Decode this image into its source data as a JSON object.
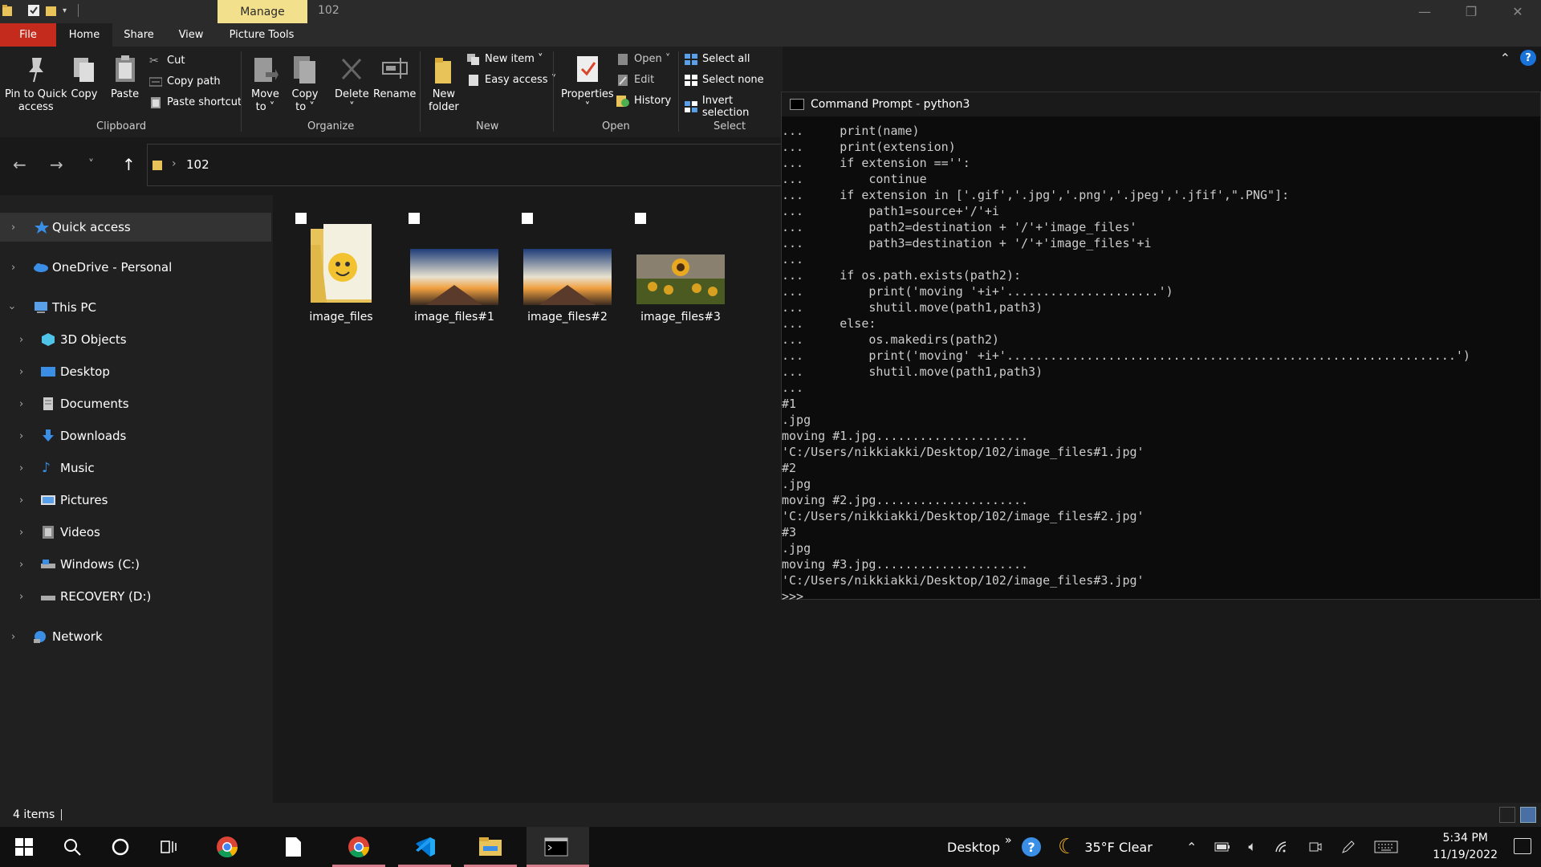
{
  "window": {
    "title": "102",
    "manage_tab": "Manage",
    "minimize": "—",
    "maximize": "❐",
    "close": "✕"
  },
  "ribbon_tabs": [
    "File",
    "Home",
    "Share",
    "View",
    "Picture Tools"
  ],
  "ribbon": {
    "clipboard": {
      "pin": "Pin to Quick",
      "pin2": "access",
      "copy": "Copy",
      "paste": "Paste",
      "cut": "Cut",
      "copy_path": "Copy path",
      "paste_shortcut": "Paste shortcut",
      "label": "Clipboard"
    },
    "organize": {
      "move_to": "Move",
      "move_to2": "to ˅",
      "copy_to": "Copy",
      "copy_to2": "to ˅",
      "delete": "Delete",
      "delete2": "˅",
      "rename": "Rename",
      "label": "Organize"
    },
    "new": {
      "new_folder": "New",
      "new_folder2": "folder",
      "new_item": "New item ˅",
      "easy_access": "Easy access ˅",
      "label": "New"
    },
    "open": {
      "properties": "Properties",
      "properties2": "˅",
      "open": "Open ˅",
      "edit": "Edit",
      "history": "History",
      "label": "Open"
    },
    "select": {
      "select_all": "Select all",
      "select_none": "Select none",
      "invert": "Invert selection",
      "label": "Select"
    }
  },
  "address": {
    "back": "←",
    "forward": "→",
    "recent": "˅",
    "up": "↑",
    "chevron": "›",
    "path": "102"
  },
  "sidebar": [
    {
      "label": "Quick access",
      "icon": "star-icon"
    },
    {
      "label": "OneDrive - Personal",
      "icon": "cloud-icon"
    },
    {
      "label": "This PC",
      "icon": "computer-icon"
    },
    {
      "label": "3D Objects",
      "icon": "cube-icon"
    },
    {
      "label": "Desktop",
      "icon": "desktop-icon"
    },
    {
      "label": "Documents",
      "icon": "document-icon"
    },
    {
      "label": "Downloads",
      "icon": "download-icon"
    },
    {
      "label": "Music",
      "icon": "music-icon"
    },
    {
      "label": "Pictures",
      "icon": "pictures-icon"
    },
    {
      "label": "Videos",
      "icon": "videos-icon"
    },
    {
      "label": "Windows (C:)",
      "icon": "drive-icon"
    },
    {
      "label": "RECOVERY (D:)",
      "icon": "drive-icon"
    },
    {
      "label": "Network",
      "icon": "network-icon"
    }
  ],
  "files": [
    {
      "name": "image_files",
      "type": "folder"
    },
    {
      "name": "image_files#1",
      "type": "image"
    },
    {
      "name": "image_files#2",
      "type": "image"
    },
    {
      "name": "image_files#3",
      "type": "image"
    }
  ],
  "status": {
    "count": "4 items"
  },
  "cmd": {
    "title": "Command Prompt - python3",
    "lines": [
      "...     print(name)",
      "...     print(extension)",
      "...     if extension =='':",
      "...         continue",
      "...     if extension in ['.gif','.jpg','.png','.jpeg','.jfif',\".PNG\"]:",
      "...         path1=source+'/'+i",
      "...         path2=destination + '/'+'image_files'",
      "...         path3=destination + '/'+'image_files'+i",
      "...",
      "...     if os.path.exists(path2):",
      "...         print('moving '+i+'.....................')",
      "...         shutil.move(path1,path3)",
      "...     else:",
      "...         os.makedirs(path2)",
      "...         print('moving' +i+'..............................................................')",
      "...         shutil.move(path1,path3)",
      "...",
      "#1",
      ".jpg",
      "moving #1.jpg.....................",
      "'C:/Users/nikkiakki/Desktop/102/image_files#1.jpg'",
      "#2",
      ".jpg",
      "moving #2.jpg.....................",
      "'C:/Users/nikkiakki/Desktop/102/image_files#2.jpg'",
      "#3",
      ".jpg",
      "moving #3.jpg.....................",
      "'C:/Users/nikkiakki/Desktop/102/image_files#3.jpg'",
      ">>>"
    ]
  },
  "taskbar": {
    "desktop_label": "Desktop",
    "chevron": "»",
    "weather": "35°F  Clear",
    "time": "5:34 PM",
    "date": "11/19/2022"
  },
  "colors": {
    "file_tab": "#c42b1c",
    "manage_tab": "#f3e08c",
    "accent_blue": "#1a73d9"
  }
}
